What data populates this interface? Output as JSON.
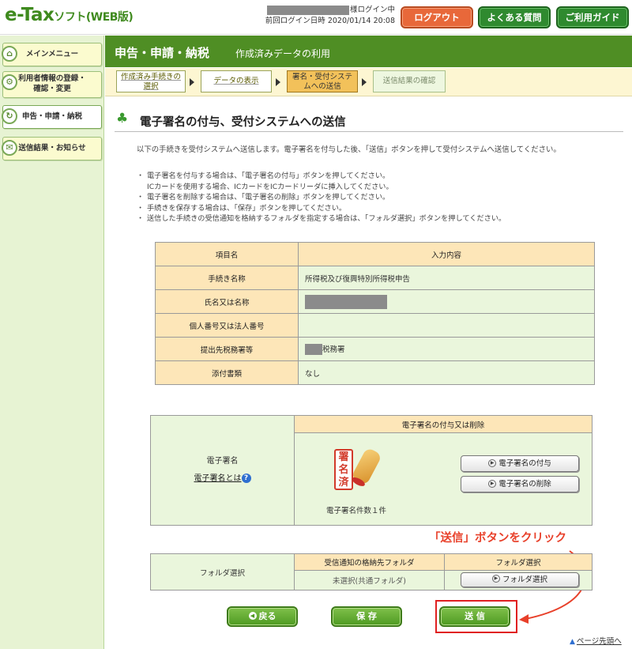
{
  "header": {
    "logo_main": "e-Tax",
    "logo_sub": "ソフト(WEB版)",
    "login_status": "様ログイン中",
    "last_login_label": "前回ログイン日時",
    "last_login_value": "2020/01/14 20:08",
    "logout_label": "ログアウト",
    "faq_label": "よくある質問",
    "guide_label": "ご利用ガイド"
  },
  "sidebar": {
    "items": [
      {
        "label": "メインメニュー",
        "icon": "home-icon"
      },
      {
        "label": "利用者情報の登録・確認・変更",
        "line1": "利用者情報の登録・",
        "line2": "確認・変更",
        "icon": "user-settings-icon"
      },
      {
        "label": "申告・申請・納税",
        "icon": "document-icon"
      },
      {
        "label": "送信結果・お知らせ",
        "icon": "mail-icon"
      }
    ]
  },
  "title_bar": {
    "main": "申告・申請・納税",
    "sub": "作成済みデータの利用"
  },
  "steps": [
    {
      "label": "作成済み手続きの選択",
      "line1": "作成済み手続きの",
      "line2": "選択",
      "state": "link"
    },
    {
      "label": "データの表示",
      "state": "link"
    },
    {
      "label": "署名・受付システムへの送信",
      "line1": "署名・受付システ",
      "line2": "ムへの送信",
      "state": "current"
    },
    {
      "label": "送信結果の確認",
      "state": "future"
    }
  ],
  "section": {
    "title": "電子署名の付与、受付システムへの送信",
    "intro": "以下の手続きを受付システムへ送信します。電子署名を付与した後、「送信」ボタンを押して受付システムへ送信してください。",
    "notes": [
      "電子署名を付与する場合は、「電子署名の付与」ボタンを押してください。",
      "ICカードを使用する場合、ICカードをICカードリーダに挿入してください。",
      "電子署名を削除する場合は、「電子署名の削除」ボタンを押してください。",
      "手続きを保存する場合は、「保存」ボタンを押してください。",
      "送信した手続きの受信通知を格納するフォルダを指定する場合は、「フォルダ選択」ボタンを押してください。"
    ]
  },
  "info_table": {
    "col_item": "項目名",
    "col_value": "入力内容",
    "rows": [
      {
        "label": "手続き名称",
        "value": "所得税及び復興特別所得税申告"
      },
      {
        "label": "氏名又は名称",
        "value": ""
      },
      {
        "label": "個人番号又は法人番号",
        "value": ""
      },
      {
        "label": "提出先税務署等",
        "value": "税務署"
      },
      {
        "label": "添付書類",
        "value": "なし"
      }
    ]
  },
  "signature": {
    "header": "電子署名の付与又は削除",
    "label": "電子署名",
    "link": "電子署名とは",
    "stamp_text": "署名済",
    "count_text": "電子署名件数１件",
    "add_button": "電子署名の付与",
    "delete_button": "電子署名の削除"
  },
  "folder": {
    "label": "フォルダ選択",
    "col_folder": "受信通知の格納先フォルダ",
    "col_select": "フォルダ選択",
    "value": "未選択(共通フォルダ)",
    "button": "フォルダ選択"
  },
  "annotation": {
    "text": "「送信」ボタンをクリック"
  },
  "actions": {
    "back": "戻る",
    "save": "保 存",
    "send": "送 信"
  },
  "page_top": "ページ先頭へ",
  "colors": {
    "brand_green": "#4f8e24",
    "logout_orange": "#e8683a",
    "annotation_red": "#e8402a",
    "table_header": "#fde6b8",
    "table_cell": "#eaf6dc"
  }
}
